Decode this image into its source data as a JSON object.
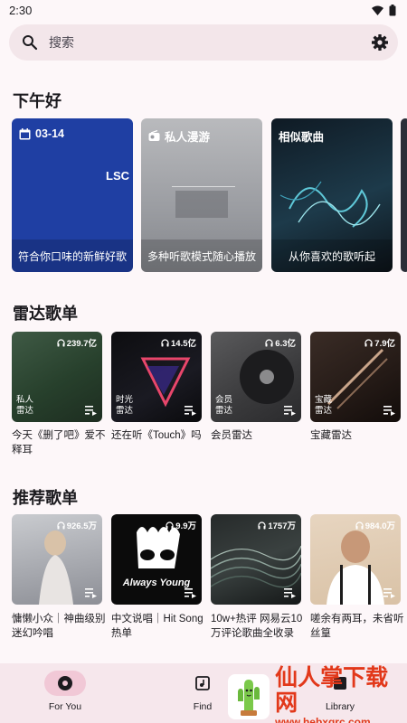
{
  "status_bar": {
    "time": "2:30"
  },
  "search": {
    "placeholder": "搜索"
  },
  "greeting": "下午好",
  "featured": [
    {
      "title": "03-14",
      "caption": "符合你口味的新鲜好歌",
      "art_text": "LSC",
      "icon": "calendar-icon"
    },
    {
      "title": "私人漫游",
      "caption": "多种听歌模式随心播放",
      "art_text": "",
      "icon": "radio-icon"
    },
    {
      "title": "相似歌曲",
      "caption": "从你喜欢的歌听起",
      "art_text": "",
      "icon": ""
    }
  ],
  "radar": {
    "title": "雷达歌单",
    "items": [
      {
        "count": "239.7亿",
        "tag": [
          "私人",
          "雷达"
        ],
        "caption": "今天《删了吧》爱不释耳"
      },
      {
        "count": "14.5亿",
        "tag": [
          "时光",
          "雷达"
        ],
        "caption": "还在听《Touch》吗"
      },
      {
        "count": "6.3亿",
        "tag": [
          "会员",
          "雷达"
        ],
        "caption": "会员雷达"
      },
      {
        "count": "7.9亿",
        "tag": [
          "宝藏",
          "雷达"
        ],
        "caption": "宝藏雷达"
      }
    ]
  },
  "recommended": {
    "title": "推荐歌单",
    "items": [
      {
        "count": "926.5万",
        "caption": "慵懒小众｜神曲级别迷幻吟唱"
      },
      {
        "count": "9.9万",
        "caption": "中文说唱｜Hit Song热单",
        "art_text": "Always Young"
      },
      {
        "count": "1757万",
        "caption": "10w+热评 网易云10万评论歌曲全收录"
      },
      {
        "count": "984.0万",
        "caption": "嗟余有两耳，未省听丝篁"
      }
    ]
  },
  "nav": [
    {
      "label": "For You",
      "icon": "for-you-icon",
      "active": true
    },
    {
      "label": "Find",
      "icon": "find-icon",
      "active": false
    },
    {
      "label": "Library",
      "icon": "library-icon",
      "active": false
    }
  ],
  "watermark": {
    "main": "仙人掌下载网",
    "url": "www.hebxqrc.com"
  },
  "colors": {
    "accent": "#f1c8d6",
    "background": "#fdf7f9",
    "nav_bg": "#f6e7ec"
  }
}
